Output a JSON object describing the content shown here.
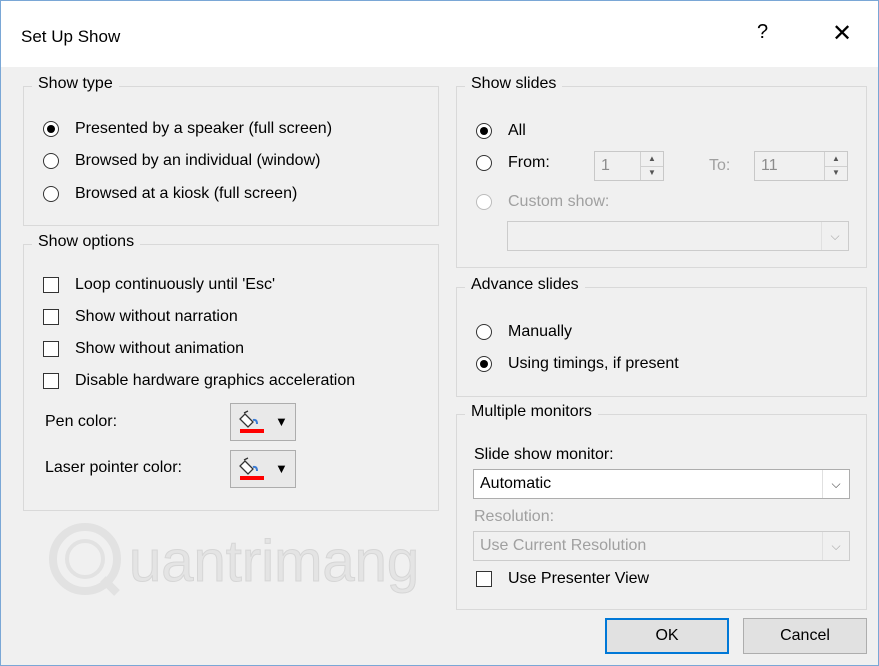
{
  "dialog": {
    "title": "Set Up Show",
    "help_label": "?",
    "close_label": "✕"
  },
  "show_type": {
    "title": "Show type",
    "options": [
      {
        "label": "Presented by a speaker (full screen)",
        "checked": true
      },
      {
        "label": "Browsed by an individual (window)",
        "checked": false
      },
      {
        "label": "Browsed at a kiosk (full screen)",
        "checked": false
      }
    ]
  },
  "show_options": {
    "title": "Show options",
    "checkboxes": [
      {
        "label": "Loop continuously until 'Esc'",
        "checked": false
      },
      {
        "label": "Show without narration",
        "checked": false
      },
      {
        "label": "Show without animation",
        "checked": false
      },
      {
        "label": "Disable hardware graphics acceleration",
        "checked": false
      }
    ],
    "pen_color_label": "Pen color:",
    "laser_color_label": "Laser pointer color:",
    "pen_color": "#ff0000",
    "laser_color": "#ff0000"
  },
  "show_slides": {
    "title": "Show slides",
    "all_label": "All",
    "from_label": "From:",
    "from_value": "1",
    "to_label": "To:",
    "to_value": "11",
    "custom_label": "Custom show:",
    "selected": "All"
  },
  "advance_slides": {
    "title": "Advance slides",
    "options": [
      {
        "label": "Manually",
        "checked": false
      },
      {
        "label": "Using timings, if present",
        "checked": true
      }
    ]
  },
  "multiple_monitors": {
    "title": "Multiple monitors",
    "monitor_label": "Slide show monitor:",
    "monitor_value": "Automatic",
    "resolution_label": "Resolution:",
    "resolution_value": "Use Current Resolution",
    "presenter_view_label": "Use Presenter View",
    "presenter_view_checked": false
  },
  "buttons": {
    "ok": "OK",
    "cancel": "Cancel"
  },
  "watermark": {
    "text": "uantrimang",
    "logo_letter": "Q"
  },
  "icons": {
    "fill_bucket": "paint-bucket-icon",
    "dropdown": "chevron-down-icon",
    "caret": "caret-down-icon"
  }
}
